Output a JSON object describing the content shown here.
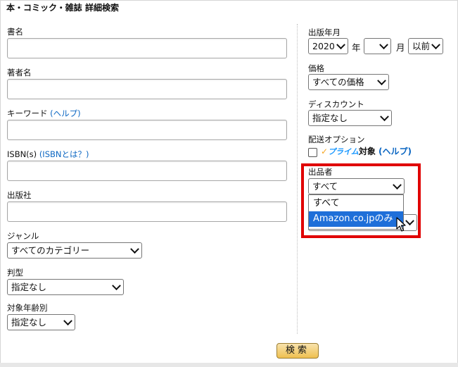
{
  "title": "本・コミック・雑誌 詳細検索",
  "left": {
    "shomei_label": "書名",
    "chosha_label": "著者名",
    "keyword_label": "キーワード",
    "keyword_help": "(ヘルプ)",
    "isbn_label": "ISBN(s)",
    "isbn_help": "(ISBNとは？)",
    "publisher_label": "出版社",
    "genre_label": "ジャンル",
    "genre_value": "すべてのカテゴリー",
    "format_label": "判型",
    "format_value": "指定なし",
    "age_label": "対象年齢別",
    "age_value": "指定なし"
  },
  "right": {
    "pubdate_label": "出版年月",
    "year_value": "2020",
    "year_unit": "年",
    "month_value": "",
    "month_unit": "月",
    "before_value": "以前",
    "price_label": "価格",
    "price_value": "すべての価格",
    "discount_label": "ディスカウント",
    "discount_value": "指定なし",
    "shipping_label": "配送オプション",
    "prime_check": "✓",
    "prime_text": "プライム",
    "prime_target": "対象",
    "prime_help": "(ヘルプ)",
    "seller_label": "出品者",
    "seller_value": "すべて",
    "seller_options": [
      "すべて",
      "Amazon.co.jpのみ"
    ]
  },
  "search_button": "検索",
  "colors": {
    "highlight": "#e00000",
    "selected_option": "#1e6fd9",
    "link": "#0b66c2"
  }
}
